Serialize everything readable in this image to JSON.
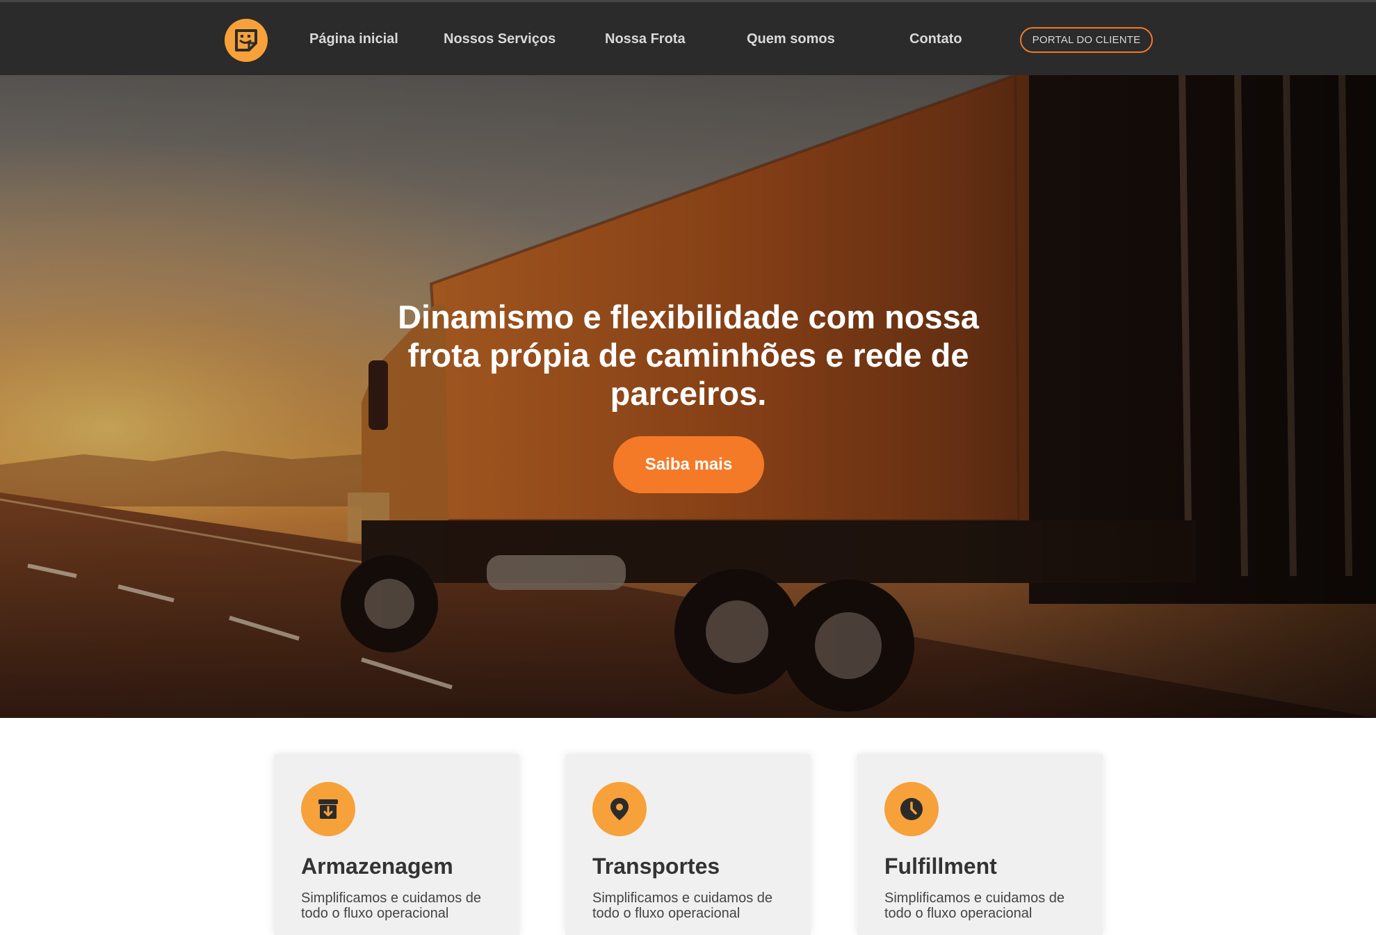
{
  "header": {
    "nav": [
      {
        "label": "Página inicial"
      },
      {
        "label": "Nossos Serviços"
      },
      {
        "label": "Nossa Frota"
      },
      {
        "label": "Quem somos"
      },
      {
        "label": "Contato"
      }
    ],
    "portal_button": "PORTAL DO CLIENTE",
    "logo_icon": "sticky-note-smile-icon"
  },
  "hero": {
    "title": "Dinamismo e flexibilidade com nossa frota própia de caminhões e rede de parceiros.",
    "cta": "Saiba mais"
  },
  "services": [
    {
      "icon": "archive-download-icon",
      "title": "Armazenagem",
      "text": "Simplificamos e cuidamos de todo o fluxo operacional"
    },
    {
      "icon": "map-pin-icon",
      "title": "Transportes",
      "text": "Simplificamos e cuidamos de todo o fluxo operacional"
    },
    {
      "icon": "clock-icon",
      "title": "Fulfillment",
      "text": "Simplificamos e cuidamos de todo o fluxo operacional"
    }
  ],
  "colors": {
    "header_bg": "#2b2b2b",
    "accent_orange": "#f47a28",
    "icon_orange": "#f7a13a",
    "card_bg": "#f0f0f0"
  }
}
